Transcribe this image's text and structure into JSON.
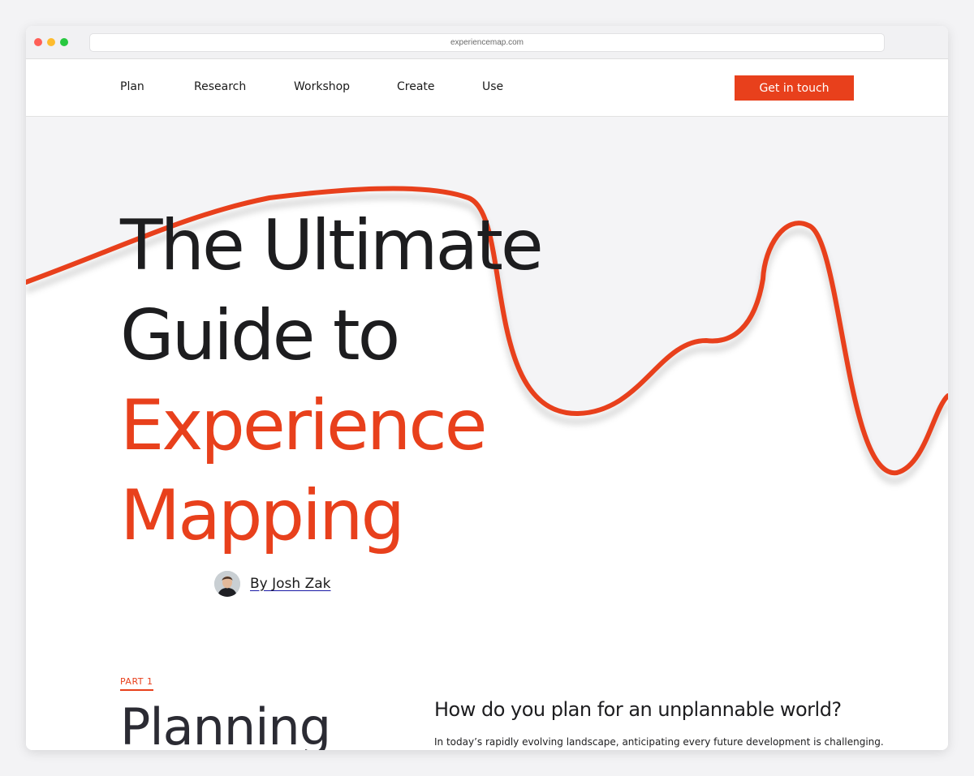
{
  "browser": {
    "url": "experiencemap.com"
  },
  "nav": {
    "links": [
      "Plan",
      "Research",
      "Workshop",
      "Create",
      "Use"
    ],
    "cta_label": "Get in touch"
  },
  "hero": {
    "title_line1": "The Ultimate",
    "title_line2": "Guide to",
    "title_line3": "Experience",
    "title_line4": "Mapping",
    "author_link": "By Josh Zak"
  },
  "part": {
    "label": "PART 1",
    "heading": "Planning",
    "question": "How do you plan for an unplannable world?",
    "intro": "In today’s rapidly evolving landscape, anticipating every future development is challenging."
  },
  "colors": {
    "accent": "#e8401c",
    "text": "#1d1d1f",
    "page_background": "#f3f3f5",
    "hero_shade": "#f4f4f6"
  },
  "icons": {
    "window_controls": [
      "close-dot",
      "minimize-dot",
      "zoom-dot"
    ],
    "author_avatar": "avatar-photo"
  }
}
